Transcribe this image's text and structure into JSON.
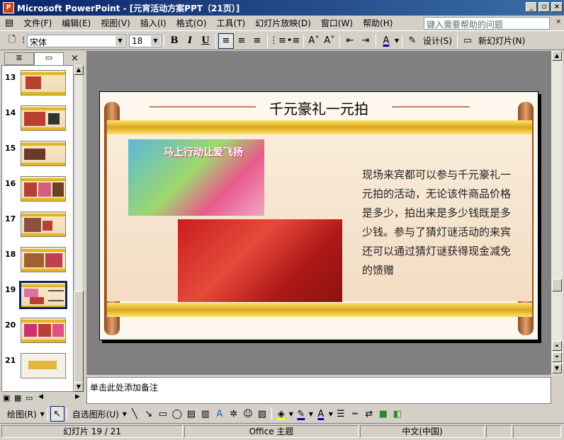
{
  "window": {
    "title": "Microsoft PowerPoint - [元宵活动方案PPT（21页）]",
    "app_icon": "P",
    "controls": [
      "minimize-icon",
      "restore-icon",
      "close-icon"
    ]
  },
  "menu": {
    "items": [
      "文件(F)",
      "编辑(E)",
      "视图(V)",
      "插入(I)",
      "格式(O)",
      "工具(T)",
      "幻灯片放映(D)",
      "窗口(W)",
      "帮助(H)"
    ],
    "help_placeholder": "键入需要帮助的问题"
  },
  "toolbar": {
    "font": "宋体",
    "size": "18",
    "bold": "B",
    "italic": "I",
    "underline": "U",
    "design_label": "设计(S)",
    "new_slide_label": "新幻灯片(N)"
  },
  "slides": {
    "numbers": [
      "13",
      "14",
      "15",
      "16",
      "17",
      "18",
      "19",
      "20",
      "21"
    ],
    "selected": "19"
  },
  "slide": {
    "title": "千元豪礼一元拍",
    "body": "现场来宾都可以参与千元豪礼一元拍的活动，无论该件商品价格是多少，拍出来是多少钱既是多少钱。参与了猜灯谜活动的来宾还可以通过猜灯谜获得现金减免的馈赠",
    "photo1_caption": "马上行动让爱飞扬"
  },
  "notes": {
    "placeholder": "单击此处添加备注"
  },
  "drawbar": {
    "draw_label": "绘图(R)",
    "autoshape_label": "自选图形(U)"
  },
  "status": {
    "slide": "幻灯片 19 / 21",
    "theme": "Office 主题",
    "language": "中文(中国)"
  }
}
